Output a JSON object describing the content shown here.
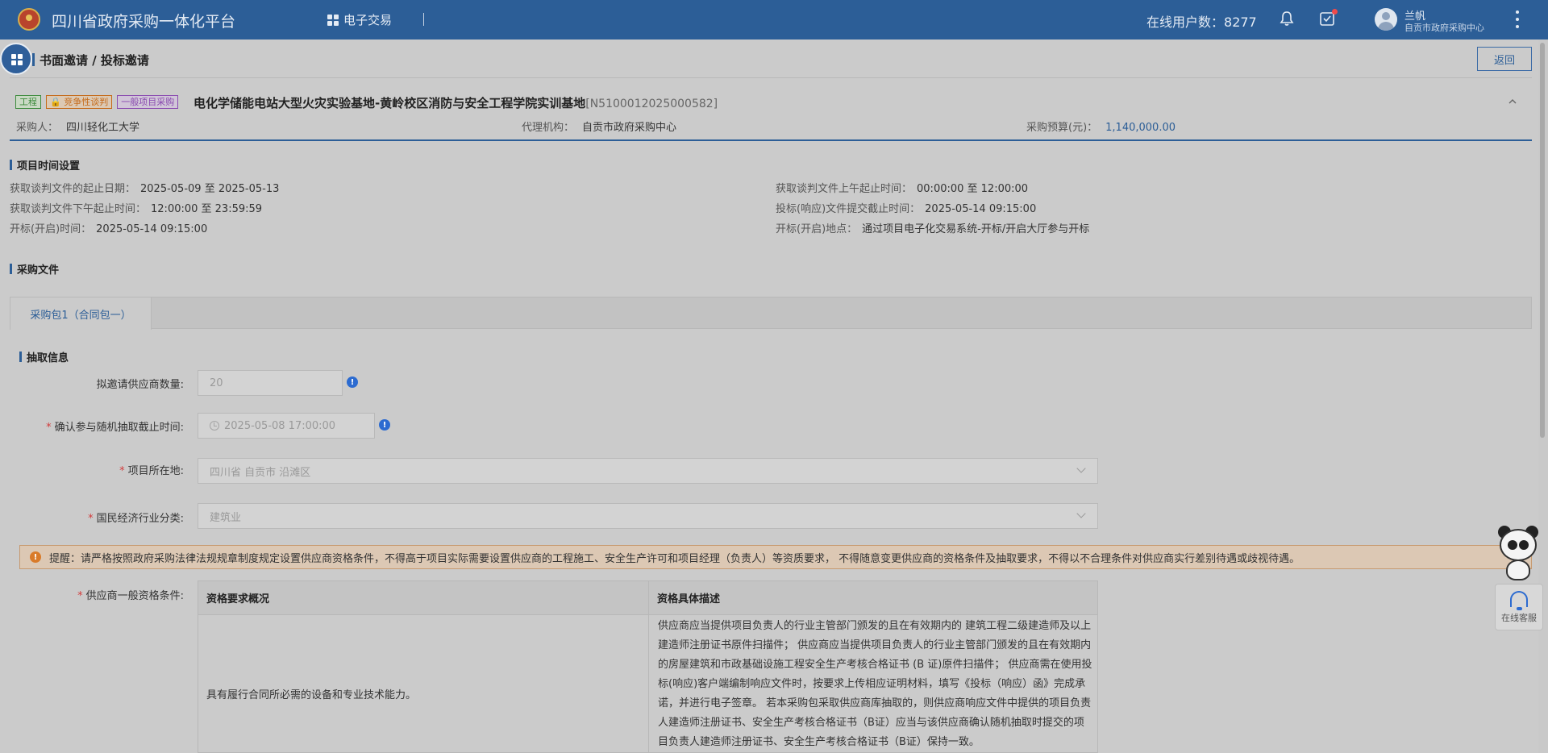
{
  "header": {
    "platform_title": "四川省政府采购一体化平台",
    "nav_etrade": "电子交易",
    "online_label": "在线用户数：",
    "online_count": "8277",
    "user_name": "兰帆",
    "user_org": "自贡市政府采购中心"
  },
  "breadcrumb": "书面邀请 / 投标邀请",
  "back_label": "返回",
  "project": {
    "tags": [
      "工程",
      "竞争性谈判",
      "一般项目采购"
    ],
    "title": "电化学储能电站大型火灾实验基地-黄岭校区消防与安全工程学院实训基地",
    "code": "[N5100012025000582]",
    "purchaser_label": "采购人：",
    "purchaser": "四川轻化工大学",
    "agency_label": "代理机构：",
    "agency": "自贡市政府采购中心",
    "budget_label": "采购预算(元)：",
    "budget": "1,140,000.00"
  },
  "time_settings": {
    "title": "项目时间设置",
    "items": [
      {
        "label": "获取谈判文件的起止日期：",
        "value": "2025-05-09 至 2025-05-13"
      },
      {
        "label": "获取谈判文件上午起止时间：",
        "value": "00:00:00 至 12:00:00"
      },
      {
        "label": "获取谈判文件下午起止时间：",
        "value": "12:00:00 至 23:59:59"
      },
      {
        "label": "投标(响应)文件提交截止时间：",
        "value": "2025-05-14 09:15:00"
      },
      {
        "label": "开标(开启)时间：",
        "value": "2025-05-14 09:15:00"
      },
      {
        "label": "开标(开启)地点：",
        "value": "通过项目电子化交易系统-开标/开启大厅参与开标"
      }
    ]
  },
  "docs_title": "采购文件",
  "tab_label": "采购包1（合同包一）",
  "extraction": {
    "title": "抽取信息",
    "supplier_count_label": "拟邀请供应商数量:",
    "supplier_count": "20",
    "deadline_label": "确认参与随机抽取截止时间:",
    "deadline": "2025-05-08 17:00:00",
    "location_label": "项目所在地:",
    "location": "四川省 自贡市 沿滩区",
    "industry_label": "国民经济行业分类:",
    "industry": "建筑业"
  },
  "warning": "提醒：请严格按照政府采购法律法规规章制度规定设置供应商资格条件，不得高于项目实际需要设置供应商的工程施工、安全生产许可和项目经理（负责人）等资质要求， 不得随意变更供应商的资格条件及抽取要求，不得以不合理条件对供应商实行差别待遇或歧视待遇。",
  "qualification": {
    "label": "供应商一般资格条件:",
    "col1": "资格要求概况",
    "col2": "资格具体描述",
    "row_summary": "具有履行合同所必需的设备和专业技术能力。",
    "row_detail": "供应商应当提供项目负责人的行业主管部门颁发的且在有效期内的 建筑工程二级建造师及以上建造师注册证书原件扫描件； 供应商应当提供项目负责人的行业主管部门颁发的且在有效期内的房屋建筑和市政基础设施工程安全生产考核合格证书 (B 证)原件扫描件； 供应商需在使用投标(响应)客户端编制响应文件时，按要求上传相应证明材料，填写《投标（响应）函》完成承诺，并进行电子签章。 若本采购包采取供应商库抽取的，则供应商响应文件中提供的项目负责人建造师注册证书、安全生产考核合格证书（B证）应当与该供应商确认随机抽取时提交的项目负责人建造师注册证书、安全生产考核合格证书（B证）保持一致。"
  },
  "support_label": "在线客服",
  "colors": {
    "brand": "#2c5e97",
    "accent": "#2c6bd0",
    "warn": "#d97b2a",
    "required": "#d23c3c"
  }
}
